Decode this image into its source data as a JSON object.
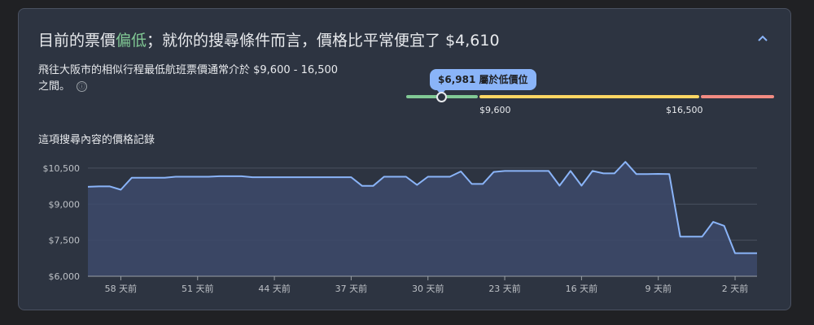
{
  "headline": {
    "prefix": "目前的票價",
    "level": "偏低",
    "suffix": "；就你的搜尋條件而言，價格比平常便宜了 $4,610"
  },
  "description": "飛往大阪市的相似行程最低航班票價通常介於 $9,600 - 16,500 之間。",
  "info_icon": "ⓘ",
  "range": {
    "bubble_text": "$6,981 屬於低價位",
    "current_price": 6981,
    "low_label": "$9,600",
    "high_label": "$16,500",
    "colors": {
      "low": "#81c995",
      "typical": "#fdd663",
      "high": "#f28b82",
      "accent": "#8ab4f8"
    }
  },
  "history_title": "這項搜尋內容的價格記錄",
  "chart_data": {
    "type": "area",
    "title": "這項搜尋內容的價格記錄",
    "xlabel": "",
    "ylabel": "",
    "ylim": [
      6000,
      10800
    ],
    "yticks": [
      {
        "value": 6000,
        "label": "$6,000"
      },
      {
        "value": 7500,
        "label": "$7,500"
      },
      {
        "value": 9000,
        "label": "$9,000"
      },
      {
        "value": 10500,
        "label": "$10,500"
      }
    ],
    "xlim": [
      61,
      0
    ],
    "xticks": [
      {
        "value": 58,
        "label": "58 天前"
      },
      {
        "value": 51,
        "label": "51 天前"
      },
      {
        "value": 44,
        "label": "44 天前"
      },
      {
        "value": 37,
        "label": "37 天前"
      },
      {
        "value": 30,
        "label": "30 天前"
      },
      {
        "value": 23,
        "label": "23 天前"
      },
      {
        "value": 16,
        "label": "16 天前"
      },
      {
        "value": 9,
        "label": "9 天前"
      },
      {
        "value": 2,
        "label": "2 天前"
      }
    ],
    "x": [
      61,
      60,
      59,
      58,
      57,
      56,
      55,
      54,
      53,
      52,
      51,
      50,
      49,
      48,
      47,
      46,
      45,
      44,
      43,
      42,
      41,
      40,
      39,
      38,
      37,
      36,
      35,
      34,
      33,
      32,
      31,
      30,
      29,
      28,
      27,
      26,
      25,
      24,
      23,
      22,
      21,
      20,
      19,
      18,
      17,
      16,
      15,
      14,
      13,
      12,
      11,
      10,
      9,
      8,
      7,
      6,
      5,
      4,
      3,
      2,
      1,
      0
    ],
    "values": [
      9720,
      9740,
      9740,
      9600,
      10100,
      10100,
      10100,
      10100,
      10140,
      10140,
      10140,
      10140,
      10160,
      10160,
      10160,
      10120,
      10120,
      10120,
      10120,
      10120,
      10120,
      10120,
      10120,
      10120,
      10120,
      9760,
      9760,
      10140,
      10140,
      10140,
      9800,
      10140,
      10140,
      10140,
      10360,
      9840,
      9840,
      10340,
      10380,
      10380,
      10380,
      10380,
      10380,
      9770,
      10380,
      9770,
      10380,
      10280,
      10280,
      10760,
      10250,
      10250,
      10260,
      10250,
      7650,
      7650,
      7650,
      8260,
      8100,
      6960,
      6960,
      6960
    ],
    "grid": true,
    "legend": "none",
    "line_color": "#8ab4f8",
    "fill_color": "#3d4a6b"
  }
}
